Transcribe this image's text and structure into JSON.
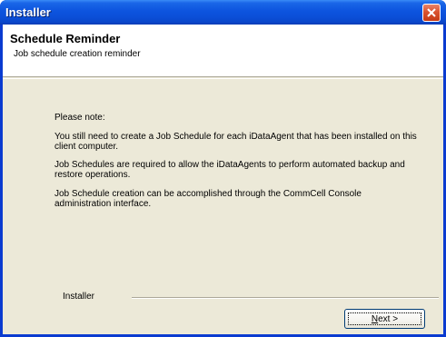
{
  "window": {
    "title": "Installer"
  },
  "header": {
    "title": "Schedule Reminder",
    "subtitle": "Job schedule creation reminder"
  },
  "body": {
    "note_heading": "Please note:",
    "paragraph_1": "You still need to create a Job Schedule for each iDataAgent that has been installed on this client computer.",
    "paragraph_2": "Job Schedules are required to allow the iDataAgents to perform automated backup and restore operations.",
    "paragraph_3": "Job Schedule creation can be accomplished through the CommCell Console administration interface."
  },
  "footer": {
    "label": "Installer",
    "next_label_prefix": "N",
    "next_label_rest": "ext >"
  },
  "colors": {
    "titlebar": "#0b4fd8",
    "client_bg": "#ece9d8",
    "close_button": "#d9532f"
  },
  "icons": {
    "close": "close-icon"
  }
}
